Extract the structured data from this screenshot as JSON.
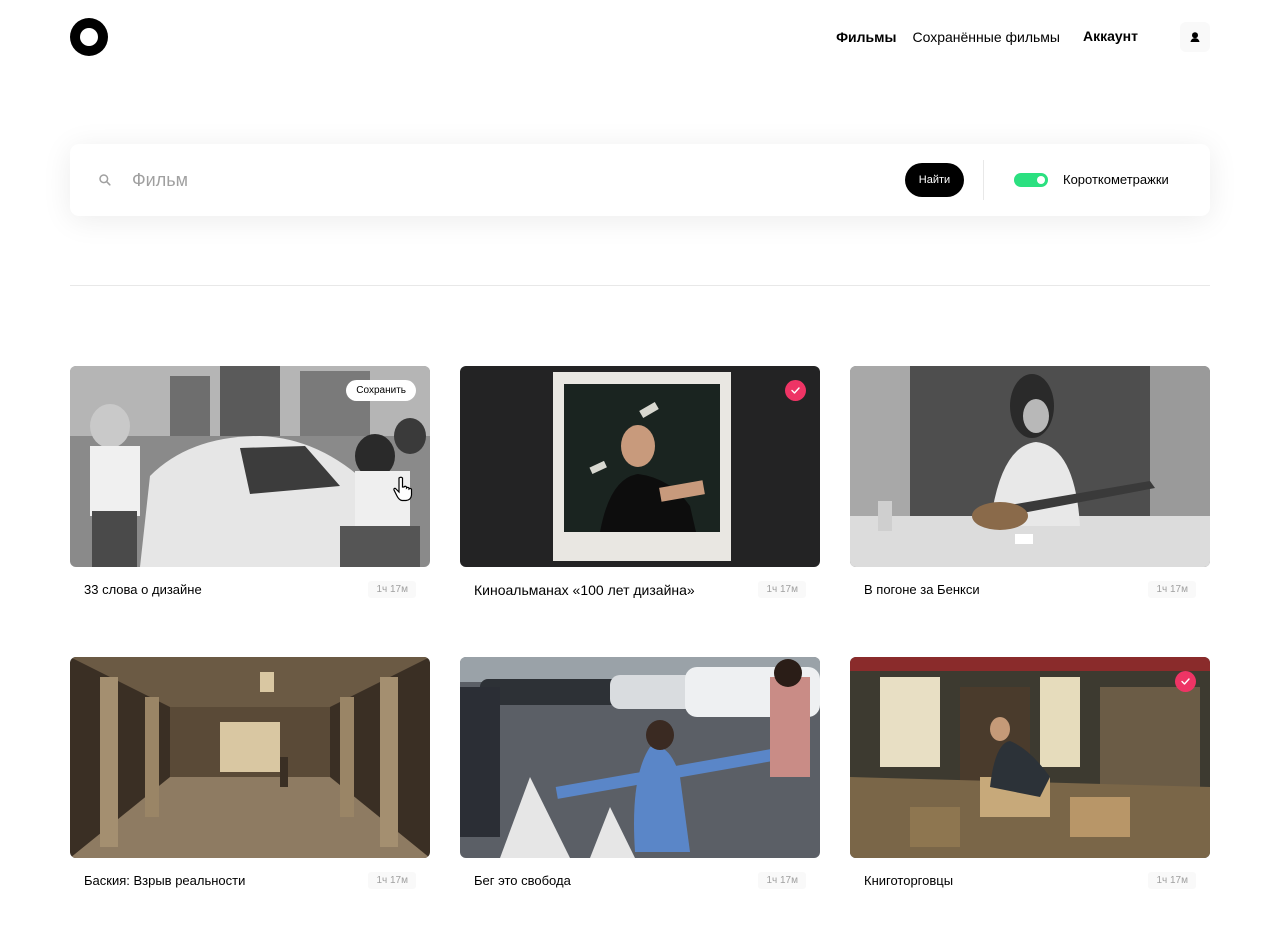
{
  "header": {
    "logo_icon": "ring-logo-icon",
    "nav": [
      {
        "label": "Фильмы",
        "active": true
      },
      {
        "label": "Сохранённые фильмы",
        "active": false
      }
    ],
    "account_label": "Аккаунт",
    "account_icon": "user-icon"
  },
  "search": {
    "placeholder": "Фильм",
    "value": "",
    "icon": "search-icon",
    "button_label": "Найти",
    "toggle_on": true,
    "toggle_label": "Короткометражки",
    "toggle_color": "#2be080"
  },
  "movies": [
    {
      "title": "33 слова о дизайне",
      "duration": "1ч 17м",
      "action": "save",
      "save_label": "Сохранить"
    },
    {
      "title": "Киноальманах «100 лет дизайна»",
      "duration": "1ч 17м",
      "action": "saved"
    },
    {
      "title": "В погоне за Бенкси",
      "duration": "1ч 17м",
      "action": "none"
    },
    {
      "title": "Баския: Взрыв реальности",
      "duration": "1ч 17м",
      "action": "none"
    },
    {
      "title": "Бег это свобода",
      "duration": "1ч 17м",
      "action": "none"
    },
    {
      "title": "Книготорговцы",
      "duration": "1ч 17м",
      "action": "saved"
    }
  ],
  "colors": {
    "accent_saved": "#ee3465",
    "toggle": "#2be080",
    "muted_text": "#a0a0a0"
  }
}
